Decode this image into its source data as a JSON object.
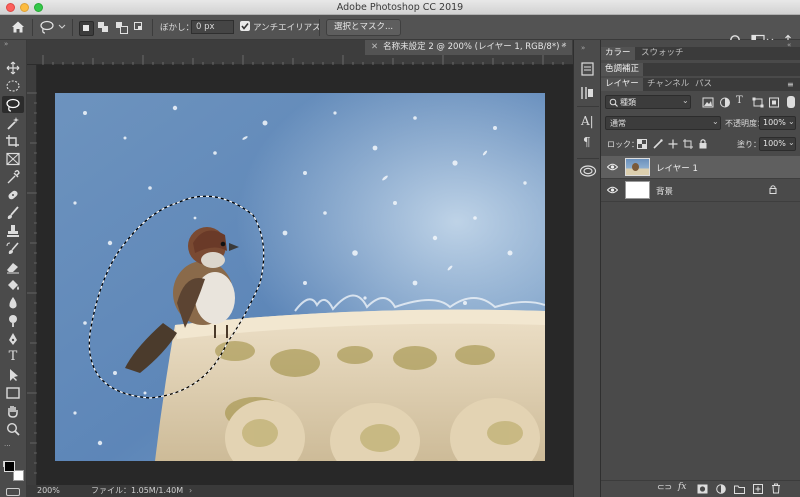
{
  "app": {
    "title": "Adobe Photoshop CC 2019"
  },
  "options_bar": {
    "feather_label": "ぼかし：",
    "feather_value": "0 px",
    "antialias_label": "アンチエイリアス",
    "antialias_checked": true,
    "select_mask_label": "選択とマスク..."
  },
  "document": {
    "tab_title": "名称未設定 2 @ 200% (レイヤー 1, RGB/8*) *",
    "zoom": "200%",
    "file_info": "ファイル：1.05M/1.40M"
  },
  "panels": {
    "top_tabs": [
      "カラー",
      "スウォッチ"
    ],
    "adjust_tab": "色調補正",
    "layer_tabs": [
      "レイヤー",
      "チャンネル",
      "パス"
    ],
    "filter_kind": "種類",
    "blend_mode": "通常",
    "opacity_label": "不透明度：",
    "opacity_value": "100%",
    "lock_label": "ロック：",
    "fill_label": "塗り：",
    "fill_value": "100%"
  },
  "layers": [
    {
      "name": "レイヤー 1",
      "selected": true
    },
    {
      "name": "背景",
      "selected": false
    }
  ],
  "tools": [
    "move-tool",
    "marquee-tool",
    "lasso-tool",
    "magic-wand-tool",
    "crop-tool",
    "frame-tool",
    "eyedropper-tool",
    "healing-brush-tool",
    "brush-tool",
    "clone-stamp-tool",
    "history-brush-tool",
    "eraser-tool",
    "paint-bucket-tool",
    "blur-tool",
    "dodge-tool",
    "pen-tool",
    "type-tool",
    "path-selection-tool",
    "rectangle-tool",
    "hand-tool",
    "zoom-tool"
  ],
  "colors": {
    "foreground": "#000000",
    "background": "#ffffff",
    "accent": "#2f7fd8"
  }
}
